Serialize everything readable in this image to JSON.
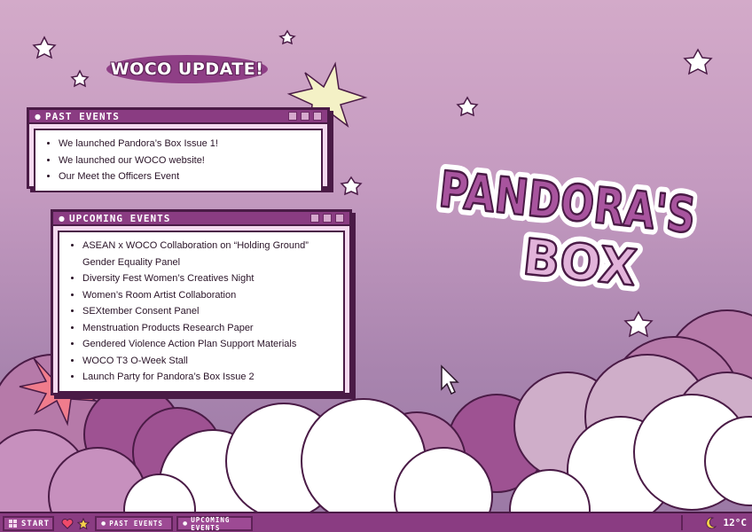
{
  "headline": {
    "text": "WOCO UPDATE!"
  },
  "logo": {
    "line1": "PANDORA'S",
    "line2": "BOX"
  },
  "past_events": {
    "title": "PAST EVENTS",
    "items": [
      "We launched Pandora’s Box Issue 1!",
      "We launched our WOCO website!",
      "Our Meet the Officers Event"
    ]
  },
  "upcoming_events": {
    "title": "UPCOMING EVENTS",
    "items": [
      "ASEAN x WOCO Collaboration on “Holding Ground”",
      "Gender Equality Panel",
      "Diversity Fest Women’s Creatives Night",
      "Women’s Room Artist Collaboration",
      "SEXtember Consent Panel",
      "Menstruation Products Research Paper",
      "Gendered Violence Action Plan Support Materials",
      "WOCO T3 O-Week Stall",
      "Launch Party for Pandora’s Box Issue 2"
    ]
  },
  "taskbar": {
    "start_label": "START",
    "icons": [
      "heart-icon",
      "star-icon"
    ],
    "tabs": [
      "PAST EVENTS",
      "UPCOMING EVENTS"
    ],
    "weather_icon": "moon-icon",
    "temperature": "12°C"
  },
  "colors": {
    "accent": "#8a3c82",
    "outline": "#4a1b46",
    "window_fill": "#f4d9ef",
    "logo_light": "#e2b3da",
    "logo_dark": "#9c4a95"
  }
}
